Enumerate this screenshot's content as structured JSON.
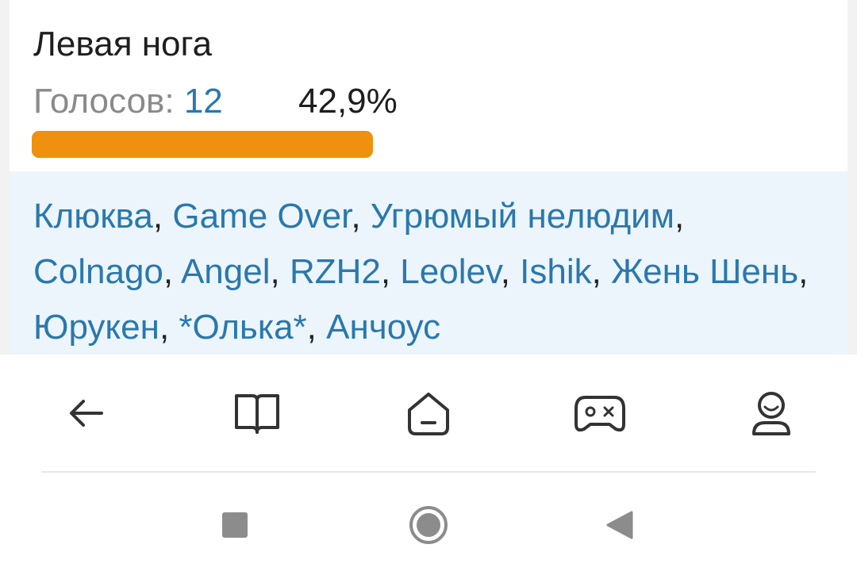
{
  "poll_option": {
    "title": "Левая нога",
    "votes_label": "Голосов: ",
    "votes_count": "12",
    "percent_text": "42,9%",
    "percent_value": 42.9,
    "bar_color": "#f0900f"
  },
  "voters": [
    "Клюква",
    "Game Over",
    "Угрюмый нелюдим",
    "Colnago",
    "Angel",
    "RZH2",
    "Leolev",
    "Ishik",
    "Жень Шень",
    "Юрукен",
    "*Олька*",
    "Анчоус"
  ],
  "voter_separator": ", ",
  "bottom_nav": {
    "items": [
      {
        "icon": "back-arrow-icon"
      },
      {
        "icon": "book-icon"
      },
      {
        "icon": "home-icon"
      },
      {
        "icon": "gamepad-icon"
      },
      {
        "icon": "profile-icon"
      }
    ]
  },
  "system_nav": {
    "items": [
      {
        "icon": "recents-square-icon"
      },
      {
        "icon": "home-circle-icon"
      },
      {
        "icon": "back-triangle-icon"
      }
    ]
  },
  "colors": {
    "link": "#2a78ad",
    "voters_panel_bg": "#ecf5fc",
    "muted_text": "#8a8a8a"
  }
}
